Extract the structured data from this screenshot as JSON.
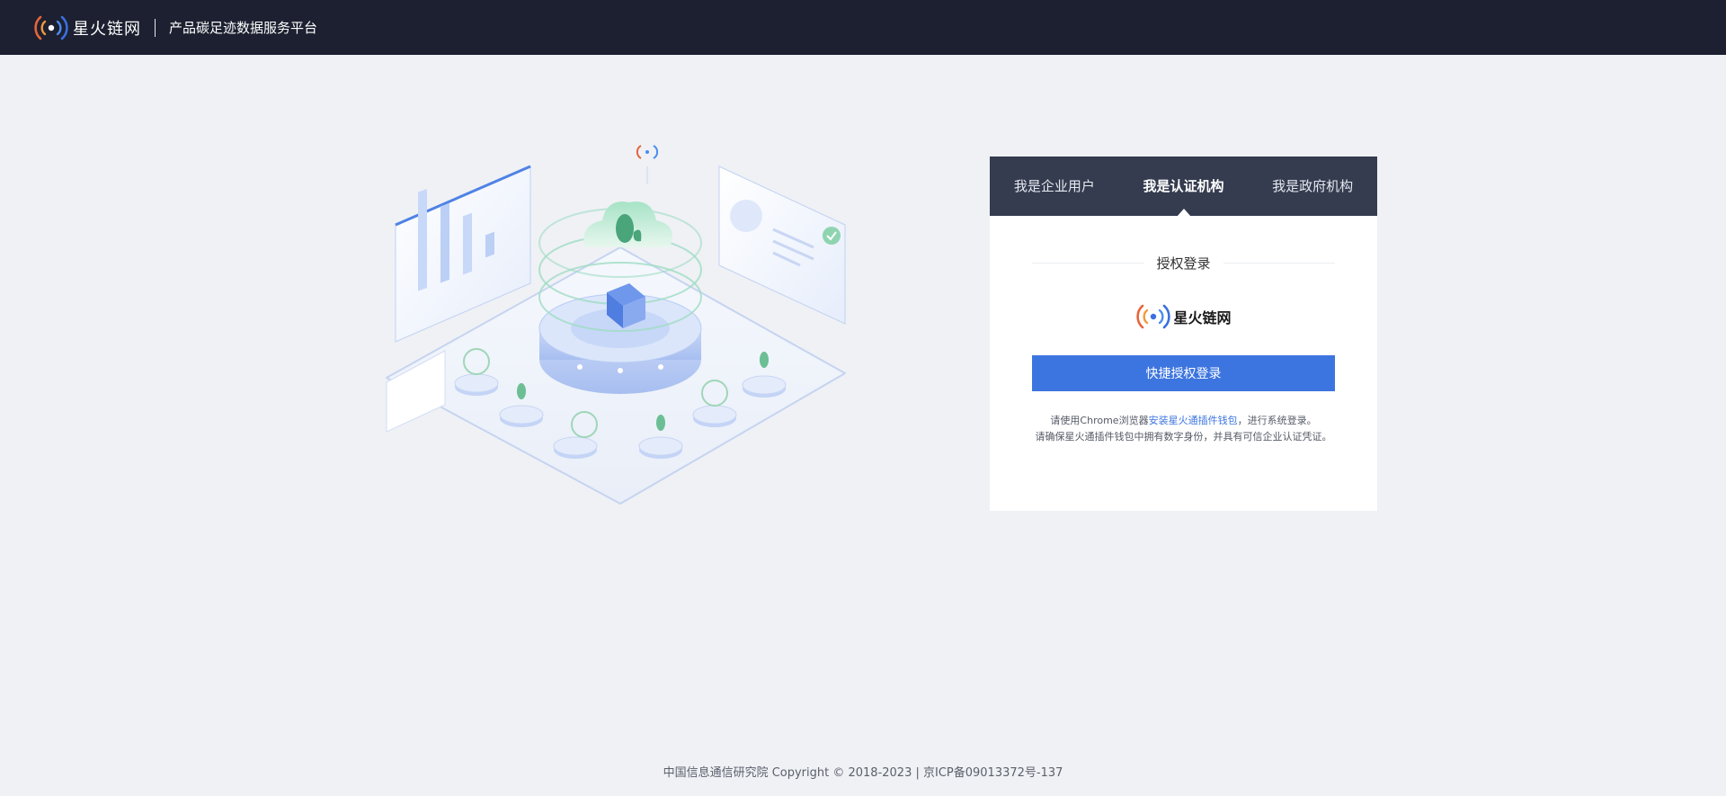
{
  "header": {
    "brand_name": "星火链网",
    "subtitle": "产品碳足迹数据服务平台"
  },
  "login": {
    "tabs": [
      {
        "label": "我是企业用户",
        "active": false
      },
      {
        "label": "我是认证机构",
        "active": true
      },
      {
        "label": "我是政府机构",
        "active": false
      }
    ],
    "section_title": "授权登录",
    "brand_name": "星火链网",
    "button_label": "快捷授权登录",
    "hint_prefix": "请使用Chrome浏览器",
    "hint_link": "安装星火通插件钱包",
    "hint_suffix": "，进行系统登录。",
    "hint_line2": "请确保星火通插件钱包中拥有数字身份，并具有可信企业认证凭证。"
  },
  "footer": {
    "text": "中国信息通信研究院 Copyright © 2018-2023 | 京ICP备09013372号-137"
  },
  "colors": {
    "header_bg": "#1c2030",
    "tab_bg": "#353c4f",
    "accent": "#3d75e0",
    "page_bg": "#eff1f5"
  },
  "icons": [
    "signal-logo-icon",
    "cloud-footprint-icon",
    "cube-grid-icon",
    "check-badge-icon",
    "co2-icon",
    "leaf-icon"
  ]
}
